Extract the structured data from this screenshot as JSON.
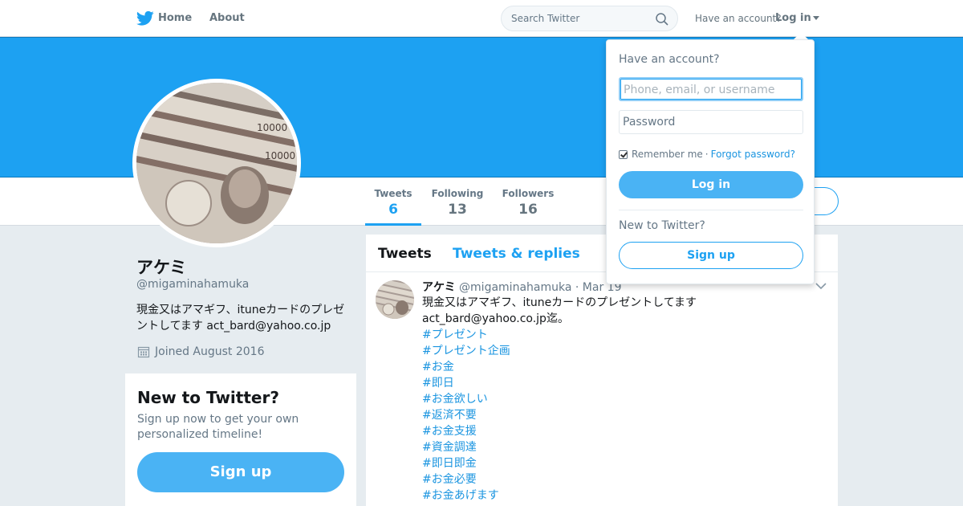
{
  "nav": {
    "home_label": "Home",
    "about_label": "About",
    "search_placeholder": "Search Twitter",
    "login_prompt": "Have an account?",
    "login_label": "Log in"
  },
  "profile": {
    "name": "アケミ",
    "handle": "@migaminahamuka",
    "bio": "現金又はアマギフ、ituneカードのプレゼントしてます act_bard@yahoo.co.jp",
    "joined": "Joined August 2016"
  },
  "stats": [
    {
      "label": "Tweets",
      "value": "6"
    },
    {
      "label": "Following",
      "value": "13"
    },
    {
      "label": "Followers",
      "value": "16"
    }
  ],
  "signup_card": {
    "title": "New to Twitter?",
    "description": "Sign up now to get your own personalized timeline!",
    "button": "Sign up"
  },
  "timeline": {
    "tabs": [
      "Tweets",
      "Tweets & replies"
    ]
  },
  "tweet": {
    "name": "アケミ",
    "handle": "@migaminahamuka",
    "dot": "·",
    "date": "Mar 19",
    "text": "現金又はアマギフ、ituneカードのプレゼントしてます act_bard@yahoo.co.jp迄。",
    "hashtags": [
      "#プレゼント",
      "#プレゼント企画",
      "#お金",
      "#即日",
      "#お金欲しい",
      "#返済不要",
      "#お金支援",
      "#資金調達",
      "#即日即金",
      "#お金必要",
      "#お金あげます"
    ]
  },
  "login_dropdown": {
    "title": "Have an account?",
    "username_placeholder": "Phone, email, or username",
    "password_placeholder": "Password",
    "remember_label": "Remember me",
    "separator": "·",
    "forgot_label": "Forgot password?",
    "login_button": "Log in",
    "new_prompt": "New to Twitter?",
    "signup_button": "Sign up"
  },
  "colors": {
    "brand": "#1da1f2",
    "banner": "#1da1f2",
    "button": "#4ab3f4",
    "link": "#1b95e0",
    "background": "#e6ecf0"
  }
}
